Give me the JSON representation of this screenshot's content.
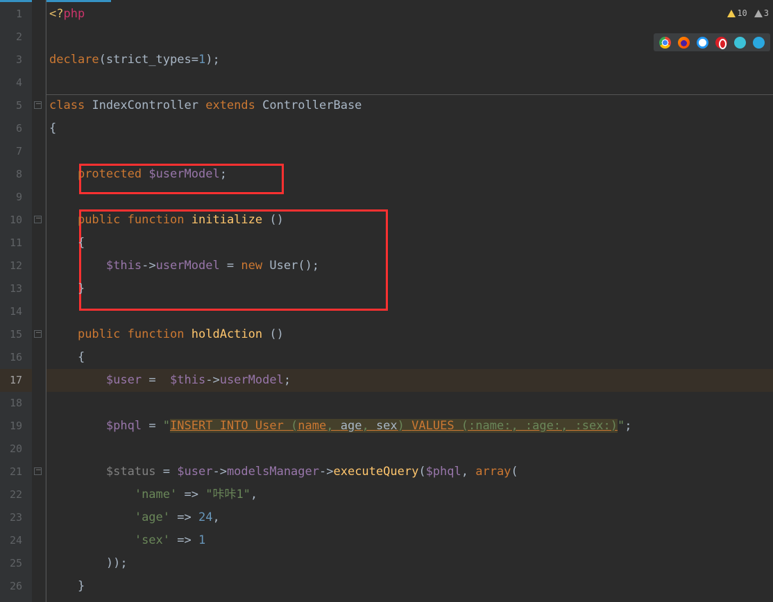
{
  "warnings": {
    "first": "10",
    "second": "3"
  },
  "lines": {
    "l1": {
      "tag_open": "<?",
      "php": "php"
    },
    "l3": {
      "declare": "declare",
      "strict": "strict_types",
      "one": "1"
    },
    "l5": {
      "class": "class",
      "name": "IndexController",
      "extends": "extends",
      "base": "ControllerBase"
    },
    "l6": {
      "brace": "{"
    },
    "l8": {
      "protected": "protected",
      "var": "$userModel",
      "semi": ";"
    },
    "l10": {
      "public": "public",
      "function": "function",
      "name": "initialize",
      "parens": " ()"
    },
    "l11": {
      "brace": "{"
    },
    "l12": {
      "this": "$this",
      "arrow": "->",
      "prop": "userModel",
      "eq": " = ",
      "new": "new",
      "user": "User",
      "tail": "();"
    },
    "l13": {
      "brace": "}"
    },
    "l15": {
      "public": "public",
      "function": "function",
      "name": "holdAction",
      "parens": " ()"
    },
    "l16": {
      "brace": "{"
    },
    "l17": {
      "user": "$user",
      "eq": " =  ",
      "this": "$this",
      "arrow": "->",
      "prop": "userModel",
      "semi": ";"
    },
    "l19": {
      "phql": "$phql",
      "eq": " = ",
      "q": "\"",
      "s1": "INSERT INTO User ",
      "p": "(",
      "n": "name",
      "c1": ", ",
      "a": "age",
      "c2": ", ",
      "s": "sex",
      "pc": ") ",
      "v": "VALUES ",
      "rest": "(:name:, :age:, :sex:)",
      "qend": "\"",
      "semi": ";"
    },
    "l21": {
      "status": "$status",
      "eq": " = ",
      "user": "$user",
      "arrow": "->",
      "mm": "modelsManager",
      "arrow2": "->",
      "eq2": "executeQuery",
      "po": "(",
      "phql": "$phql",
      "c": ", ",
      "array": "array",
      "po2": "("
    },
    "l22": {
      "k": "'name'",
      "ar": " => ",
      "v": "\"咔咔1\"",
      "c": ","
    },
    "l23": {
      "k": "'age'",
      "ar": " => ",
      "v": "24",
      "c": ","
    },
    "l24": {
      "k": "'sex'",
      "ar": " => ",
      "v": "1"
    },
    "l25": {
      "close": "));"
    },
    "l26": {
      "brace": "}"
    }
  },
  "line_numbers": [
    "1",
    "2",
    "3",
    "4",
    "5",
    "6",
    "7",
    "8",
    "9",
    "10",
    "11",
    "12",
    "13",
    "14",
    "15",
    "16",
    "17",
    "18",
    "19",
    "20",
    "21",
    "22",
    "23",
    "24",
    "25",
    "26"
  ]
}
